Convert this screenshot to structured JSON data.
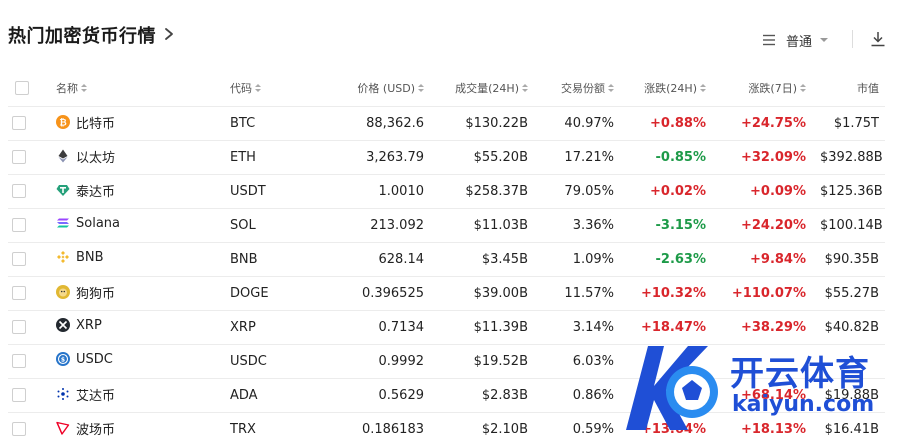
{
  "header": {
    "title": "热门加密货币行情",
    "view_mode": "普通"
  },
  "table": {
    "columns": {
      "name": "名称",
      "code": "代码",
      "price": "价格 (USD)",
      "volume": "成交量(24H)",
      "share": "交易份额",
      "chg24": "涨跌(24H)",
      "chg7": "涨跌(7日)",
      "cap": "市值"
    },
    "rows": [
      {
        "name": "比特币",
        "icon": "bitcoin-icon",
        "code": "BTC",
        "price": "88,362.6",
        "volume": "$130.22B",
        "share": "40.97%",
        "chg24": "+0.88%",
        "chg24_dir": "up",
        "chg7": "+24.75%",
        "chg7_dir": "up",
        "cap": "$1.75T"
      },
      {
        "name": "以太坊",
        "icon": "ethereum-icon",
        "code": "ETH",
        "price": "3,263.79",
        "volume": "$55.20B",
        "share": "17.21%",
        "chg24": "-0.85%",
        "chg24_dir": "down",
        "chg7": "+32.09%",
        "chg7_dir": "up",
        "cap": "$392.88B"
      },
      {
        "name": "泰达币",
        "icon": "tether-icon",
        "code": "USDT",
        "price": "1.0010",
        "volume": "$258.37B",
        "share": "79.05%",
        "chg24": "+0.02%",
        "chg24_dir": "up",
        "chg7": "+0.09%",
        "chg7_dir": "up",
        "cap": "$125.36B"
      },
      {
        "name": "Solana",
        "icon": "solana-icon",
        "code": "SOL",
        "price": "213.092",
        "volume": "$11.03B",
        "share": "3.36%",
        "chg24": "-3.15%",
        "chg24_dir": "down",
        "chg7": "+24.20%",
        "chg7_dir": "up",
        "cap": "$100.14B"
      },
      {
        "name": "BNB",
        "icon": "bnb-icon",
        "code": "BNB",
        "price": "628.14",
        "volume": "$3.45B",
        "share": "1.09%",
        "chg24": "-2.63%",
        "chg24_dir": "down",
        "chg7": "+9.84%",
        "chg7_dir": "up",
        "cap": "$90.35B"
      },
      {
        "name": "狗狗币",
        "icon": "dogecoin-icon",
        "code": "DOGE",
        "price": "0.396525",
        "volume": "$39.00B",
        "share": "11.57%",
        "chg24": "+10.32%",
        "chg24_dir": "up",
        "chg7": "+110.07%",
        "chg7_dir": "up",
        "cap": "$55.27B"
      },
      {
        "name": "XRP",
        "icon": "xrp-icon",
        "code": "XRP",
        "price": "0.7134",
        "volume": "$11.39B",
        "share": "3.14%",
        "chg24": "+18.47%",
        "chg24_dir": "up",
        "chg7": "+38.29%",
        "chg7_dir": "up",
        "cap": "$40.82B"
      },
      {
        "name": "USDC",
        "icon": "usdc-icon",
        "code": "USDC",
        "price": "0.9992",
        "volume": "$19.52B",
        "share": "6.03%",
        "chg24": "",
        "chg24_dir": "up",
        "chg7": "",
        "chg7_dir": "down",
        "cap": ""
      },
      {
        "name": "艾达币",
        "icon": "cardano-icon",
        "code": "ADA",
        "price": "0.5629",
        "volume": "$2.83B",
        "share": "0.86%",
        "chg24": "",
        "chg24_dir": "up",
        "chg7": "+68.14%",
        "chg7_dir": "up",
        "cap": "$19.88B"
      },
      {
        "name": "波场币",
        "icon": "tron-icon",
        "code": "TRX",
        "price": "0.186183",
        "volume": "$2.10B",
        "share": "0.59%",
        "chg24": "+13.64%",
        "chg24_dir": "up",
        "chg7": "+18.13%",
        "chg7_dir": "up",
        "cap": "$16.41B"
      }
    ]
  },
  "watermark": {
    "text_cn": "开云体育",
    "text_en": "kaiyun.com"
  },
  "colors": {
    "up": "#d9262c",
    "down": "#1d9a48",
    "watermark": "#1f4fd6"
  }
}
